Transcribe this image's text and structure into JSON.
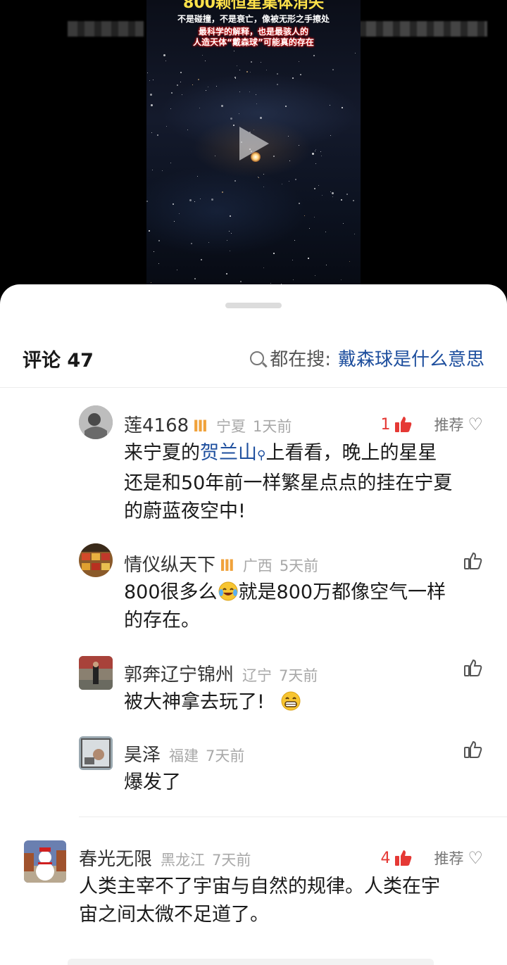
{
  "video": {
    "title": "800颗恒星集体消失",
    "subtitle": "不是碰撞，不是衰亡，像被无形之手擦处",
    "caption_line1": "最科学的解释，也是最骇人的",
    "caption_line2": "人造天体“戴森球”可能真的存在"
  },
  "header": {
    "title": "评论 47",
    "search_prefix": "都在搜:",
    "search_term": "戴森球是什么意思"
  },
  "comments": [
    {
      "user": "莲4168",
      "region": "宁夏",
      "time": "1天前",
      "likes": "1",
      "recommend": "推荐",
      "text_before": "来宁夏的",
      "link": "贺兰山",
      "text_after": "上看看，晚上的星星",
      "line2": "还是和50年前一样繁星点点的挂在宁夏",
      "line3": "的蔚蓝夜空中!"
    },
    {
      "user": "情仪纵天下",
      "region": "广西",
      "time": "5天前",
      "text_before": "800很多么",
      "text_after": "就是800万都像空气一样",
      "line2": "的存在。"
    },
    {
      "user": "郭奔辽宁锦州",
      "region": "辽宁",
      "time": "7天前",
      "text": "被大神拿去玩了!"
    },
    {
      "user": "昊泽",
      "region": "福建",
      "time": "7天前",
      "text": "爆发了"
    },
    {
      "user": "春光无限",
      "region": "黑龙江",
      "time": "7天前",
      "likes": "4",
      "recommend": "推荐",
      "line1": "人类主宰不了宇宙与自然的规律。人类在宇",
      "line2": "宙之间太微不足道了。"
    }
  ],
  "colors": {
    "link": "#1e4f9e",
    "like_red": "#e53935",
    "vip": "#f0a23b"
  }
}
